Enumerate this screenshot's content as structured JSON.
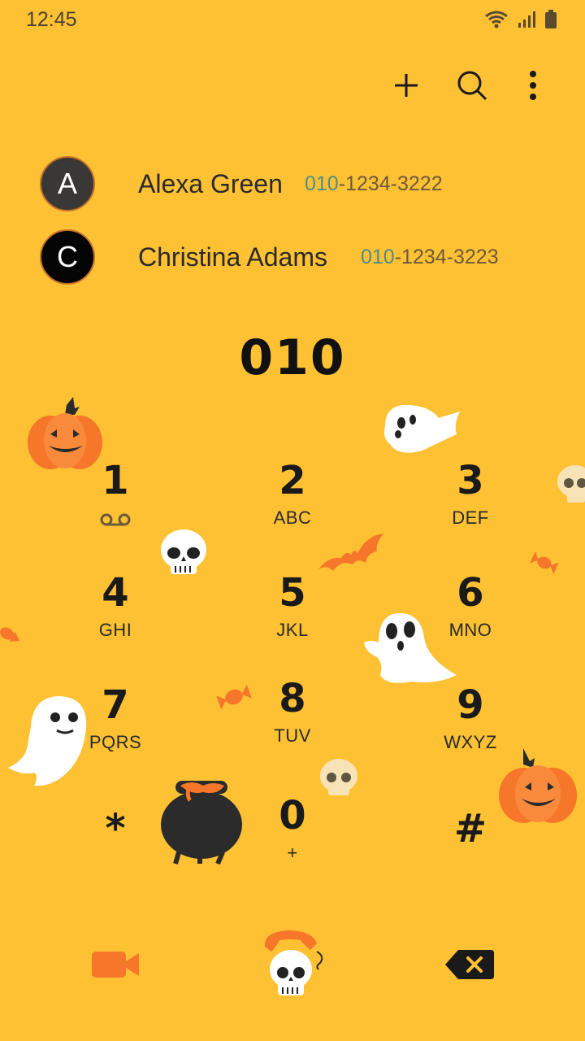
{
  "status_bar": {
    "time": "12:45"
  },
  "toolbar": {
    "add_icon": "plus-icon",
    "search_icon": "search-icon",
    "more_icon": "more-vert-icon"
  },
  "contacts": [
    {
      "initial": "A",
      "name": "Alexa Green",
      "number_match": "010",
      "number_rest": "-1234-3222",
      "avatar_color": "#3a3836"
    },
    {
      "initial": "C",
      "name": "Christina Adams",
      "number_match": "010",
      "number_rest": "-1234-3223",
      "avatar_color": "#050505"
    }
  ],
  "dialer": {
    "number": "010"
  },
  "keypad": [
    {
      "digit": "1",
      "letters": ""
    },
    {
      "digit": "2",
      "letters": "ABC"
    },
    {
      "digit": "3",
      "letters": "DEF"
    },
    {
      "digit": "4",
      "letters": "GHI"
    },
    {
      "digit": "5",
      "letters": "JKL"
    },
    {
      "digit": "6",
      "letters": "MNO"
    },
    {
      "digit": "7",
      "letters": "PQRS"
    },
    {
      "digit": "8",
      "letters": "TUV"
    },
    {
      "digit": "9",
      "letters": "WXYZ"
    },
    {
      "digit": "*",
      "letters": ""
    },
    {
      "digit": "0",
      "letters": "+"
    },
    {
      "digit": "#",
      "letters": ""
    }
  ],
  "bottom_bar": {
    "video_icon": "video-call-icon",
    "call_icon": "call-icon",
    "backspace_icon": "backspace-icon"
  },
  "colors": {
    "background": "#FEC133",
    "accent_orange": "#F7772A",
    "match_highlight": "#4f8e8a"
  }
}
